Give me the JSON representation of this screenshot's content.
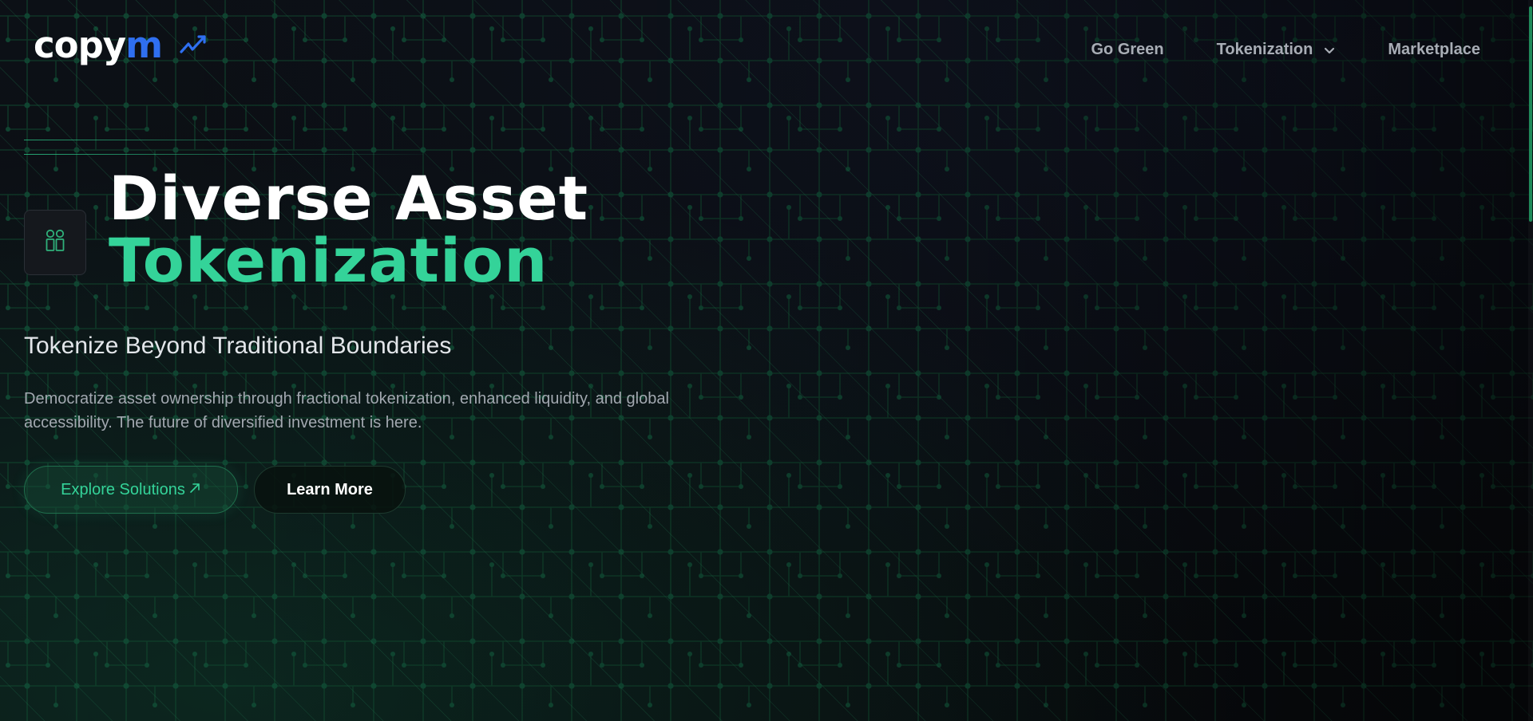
{
  "brand": {
    "name_main": "copy",
    "name_accent": "m",
    "mark_icon": "trend-up-icon",
    "accent_color": "#2f6ff0"
  },
  "nav": {
    "items": [
      {
        "label": "Go Green"
      },
      {
        "label": "Tokenization",
        "icon": "chevron-down-icon"
      },
      {
        "label": "Marketplace"
      }
    ]
  },
  "hero": {
    "badge_icon": "tokenization-blocks-icon",
    "title_line1": "Diverse Asset",
    "title_line2": "Tokenization",
    "subtitle": "Tokenize Beyond Traditional Boundaries",
    "description": "Democratize asset ownership through fractional tokenization, enhanced liquidity, and global accessibility. The future of diversified investment is here.",
    "primary_button": {
      "label": "Explore Solutions",
      "icon": "arrow-up-right-icon"
    },
    "secondary_button": {
      "label": "Learn More"
    }
  },
  "colors": {
    "background": "#0b0e12",
    "accent_green": "#34d399",
    "nav_text": "#a8adb5"
  }
}
